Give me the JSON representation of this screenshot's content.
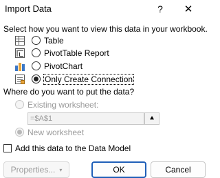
{
  "window": {
    "title": "Import Data",
    "help_glyph": "?",
    "close_glyph": "✕"
  },
  "view_section": {
    "heading": "Select how you want to view this data in your workbook.",
    "options": [
      {
        "label": "Table",
        "icon": "table-icon",
        "selected": false
      },
      {
        "label": "PivotTable Report",
        "icon": "pivottable-icon",
        "selected": false
      },
      {
        "label": "PivotChart",
        "icon": "pivotchart-icon",
        "selected": false
      },
      {
        "label": "Only Create Connection",
        "icon": "connection-icon",
        "selected": true
      }
    ]
  },
  "location_section": {
    "heading": "Where do you want to put the data?",
    "existing_label": "Existing worksheet:",
    "reference_value": "=$A$1",
    "collapse_glyph": "⯅",
    "new_label": "New worksheet",
    "selected": "New worksheet"
  },
  "data_model": {
    "label": "Add this data to the Data Model",
    "checked": false
  },
  "buttons": {
    "properties": "Properties...",
    "properties_dropdown": "▾",
    "ok": "OK",
    "cancel": "Cancel"
  },
  "colors": {
    "accent": "#1f5fb8",
    "disabled_text": "#9a9a9a"
  }
}
